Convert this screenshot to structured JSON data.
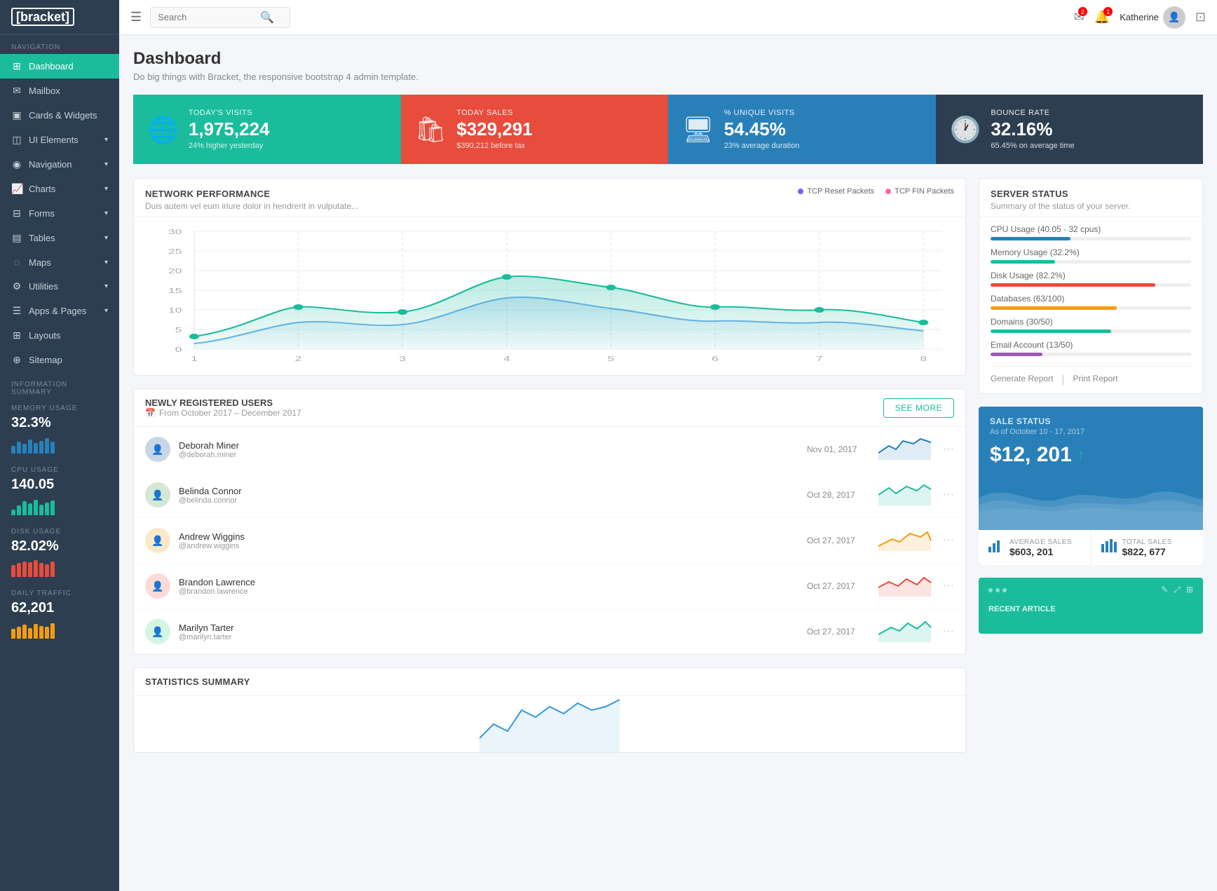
{
  "sidebar": {
    "logo": "[bracket]",
    "nav_label": "NAVIGATION",
    "items": [
      {
        "id": "dashboard",
        "label": "Dashboard",
        "icon": "⊞",
        "active": true
      },
      {
        "id": "mailbox",
        "label": "Mailbox",
        "icon": "✉"
      },
      {
        "id": "cards-widgets",
        "label": "Cards & Widgets",
        "icon": "▣"
      },
      {
        "id": "ui-elements",
        "label": "UI Elements",
        "icon": "◫",
        "has_children": true
      },
      {
        "id": "navigation",
        "label": "Navigation",
        "icon": "◉",
        "has_children": true
      },
      {
        "id": "charts",
        "label": "Charts",
        "icon": "📈",
        "has_children": true
      },
      {
        "id": "forms",
        "label": "Forms",
        "icon": "⊟",
        "has_children": true
      },
      {
        "id": "tables",
        "label": "Tables",
        "icon": "▤",
        "has_children": true
      },
      {
        "id": "maps",
        "label": "Maps",
        "icon": "◌",
        "has_children": true
      },
      {
        "id": "utilities",
        "label": "Utilities",
        "icon": "⚙",
        "has_children": true
      },
      {
        "id": "apps-pages",
        "label": "Apps & Pages",
        "icon": "☰",
        "has_children": true
      },
      {
        "id": "layouts",
        "label": "Layouts",
        "icon": "⊞"
      },
      {
        "id": "sitemap",
        "label": "Sitemap",
        "icon": "⊕"
      }
    ],
    "info_section_label": "INFORMATION SUMMARY",
    "info_blocks": [
      {
        "id": "memory",
        "label": "MEMORY USAGE",
        "value": "32.3%",
        "color": "#2980b9",
        "bars": [
          40,
          60,
          50,
          70,
          55,
          65,
          80,
          60
        ]
      },
      {
        "id": "cpu",
        "label": "CPU USAGE",
        "value": "140.05",
        "color": "#1abc9c",
        "bars": [
          30,
          50,
          70,
          60,
          80,
          55,
          65,
          75
        ]
      },
      {
        "id": "disk",
        "label": "DISK USAGE",
        "value": "82.02%",
        "color": "#e74c3c",
        "bars": [
          60,
          70,
          80,
          75,
          85,
          70,
          65,
          80
        ]
      },
      {
        "id": "traffic",
        "label": "DAILY TRAFFIC",
        "value": "62,201",
        "color": "#f39c12",
        "bars": [
          50,
          60,
          70,
          55,
          75,
          65,
          60,
          80
        ]
      }
    ]
  },
  "topbar": {
    "hamburger_title": "menu",
    "search_placeholder": "Search",
    "username": "Katherine",
    "notifications_count": "1",
    "messages_count": "2"
  },
  "page": {
    "title": "Dashboard",
    "subtitle": "Do big things with Bracket, the responsive bootstrap 4 admin template."
  },
  "stat_cards": [
    {
      "id": "visits",
      "label": "TODAY'S VISITS",
      "value": "1,975,224",
      "sub": "24% higher yesterday",
      "color": "green",
      "icon": "🌐"
    },
    {
      "id": "sales",
      "label": "TODAY SALES",
      "value": "$329,291",
      "sub": "$390,212 before tax",
      "color": "red",
      "icon": "🛍"
    },
    {
      "id": "unique",
      "label": "% UNIQUE VISITS",
      "value": "54.45%",
      "sub": "23% average duration",
      "color": "blue",
      "icon": "🖥"
    },
    {
      "id": "bounce",
      "label": "BOUNCE RATE",
      "value": "32.16%",
      "sub": "65.45% on average time",
      "color": "dark",
      "icon": "🕐"
    }
  ],
  "network_chart": {
    "title": "NETWORK PERFORMANCE",
    "subtitle": "Duis autem vel eum iriure dolor in hendrerit in vulputate...",
    "legend": [
      {
        "label": "TCP Reset Packets",
        "color": "#6c63ff"
      },
      {
        "label": "TCP FIN Packets",
        "color": "#ff6b9d"
      }
    ],
    "y_labels": [
      "30",
      "25",
      "20",
      "15",
      "10",
      "5",
      "0"
    ],
    "x_labels": [
      "1",
      "2",
      "3",
      "4",
      "5",
      "6",
      "7",
      "8"
    ]
  },
  "server_status": {
    "title": "SERVER STATUS",
    "subtitle": "Summary of the status of your server.",
    "items": [
      {
        "label": "CPU Usage (40.05 - 32 cpus)",
        "value": 40,
        "color": "#2980b9"
      },
      {
        "label": "Memory Usage (32.2%)",
        "value": 32,
        "color": "#1abc9c"
      },
      {
        "label": "Disk Usage (82.2%)",
        "value": 82,
        "color": "#e74c3c"
      },
      {
        "label": "Databases (63/100)",
        "value": 63,
        "color": "#f39c12"
      },
      {
        "label": "Domains (30/50)",
        "value": 60,
        "color": "#1abc9c"
      },
      {
        "label": "Email Account (13/50)",
        "value": 26,
        "color": "#9b59b6"
      }
    ],
    "action1": "Generate Report",
    "action2": "Print Report"
  },
  "users_table": {
    "title": "NEWLY REGISTERED USERS",
    "date_range": "From October 2017 – December 2017",
    "see_more": "SEE MORE",
    "users": [
      {
        "name": "Deborah Miner",
        "handle": "@deborah.miner",
        "date": "Nov 01, 2017",
        "spark_color": "#2980b9"
      },
      {
        "name": "Belinda Connor",
        "handle": "@belinda.connor",
        "date": "Oct 28, 2017",
        "spark_color": "#1abc9c"
      },
      {
        "name": "Andrew Wiggins",
        "handle": "@andrew.wiggins",
        "date": "Oct 27, 2017",
        "spark_color": "#f39c12"
      },
      {
        "name": "Brandon Lawrence",
        "handle": "@brandon.lawrence",
        "date": "Oct 27, 2017",
        "spark_color": "#e74c3c"
      },
      {
        "name": "Marilyn Tarter",
        "handle": "@marilyn.tarter",
        "date": "Oct 27, 2017",
        "spark_color": "#1abc9c"
      }
    ]
  },
  "sale_status": {
    "title": "SALE STATUS",
    "date": "As of October 10 - 17, 2017",
    "value": "$12, 201",
    "arrow": "↑",
    "avg_label": "AVERAGE SALES",
    "avg_value": "$603, 201",
    "total_label": "TOTAL SALES",
    "total_value": "$822, 677"
  },
  "recent_article": {
    "title": "RECENT ARTICLE"
  },
  "stats_summary": {
    "title": "STATISTICS SUMMARY"
  }
}
